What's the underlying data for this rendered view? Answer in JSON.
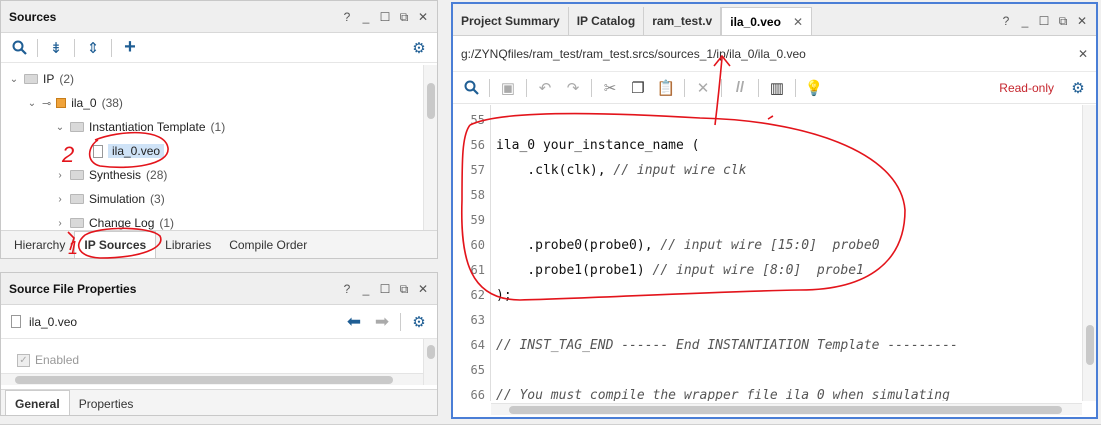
{
  "sources": {
    "title": "Sources",
    "tree": [
      {
        "label": "IP",
        "count": "(2)"
      },
      {
        "label": "ila_0",
        "count": "(38)"
      },
      {
        "label": "Instantiation Template",
        "count": "(1)"
      },
      {
        "label": "ila_0.veo",
        "count": ""
      },
      {
        "label": "Synthesis",
        "count": "(28)"
      },
      {
        "label": "Simulation",
        "count": "(3)"
      },
      {
        "label": "Change Log",
        "count": "(1)"
      }
    ],
    "tabs": [
      "Hierarchy",
      "IP Sources",
      "Libraries",
      "Compile Order"
    ]
  },
  "properties": {
    "title": "Source File Properties",
    "file": "ila_0.veo",
    "enabled_label": "Enabled",
    "tabs": [
      "General",
      "Properties"
    ]
  },
  "editor": {
    "tabs": [
      "Project Summary",
      "IP Catalog",
      "ram_test.v",
      "ila_0.veo"
    ],
    "path": "g:/ZYNQfiles/ram_test/ram_test.srcs/sources_1/ip/ila_0/ila_0.veo",
    "readonly": "Read-only",
    "lines": [
      {
        "n": "55",
        "code": "",
        "comment": ""
      },
      {
        "n": "56",
        "code": "ila_0 your_instance_name (",
        "comment": ""
      },
      {
        "n": "57",
        "code": "    .clk(clk), ",
        "comment": "// input wire clk"
      },
      {
        "n": "58",
        "code": "",
        "comment": ""
      },
      {
        "n": "59",
        "code": "",
        "comment": ""
      },
      {
        "n": "60",
        "code": "    .probe0(probe0), ",
        "comment": "// input wire [15:0]  probe0"
      },
      {
        "n": "61",
        "code": "    .probe1(probe1) ",
        "comment": "// input wire [8:0]  probe1"
      },
      {
        "n": "62",
        "code": ");",
        "comment": ""
      },
      {
        "n": "63",
        "code": "",
        "comment": ""
      },
      {
        "n": "64",
        "code": "",
        "comment": "// INST_TAG_END ------ End INSTANTIATION Template ---------"
      },
      {
        "n": "65",
        "code": "",
        "comment": ""
      },
      {
        "n": "66",
        "code": "",
        "comment": "// You must compile the wrapper file ila_0 when simulating"
      }
    ]
  },
  "annotations": {
    "mark1": "1",
    "mark2": "2"
  },
  "colors": {
    "accent": "#1f5e94",
    "readonly": "#c6262e",
    "annotation": "#e3141b",
    "editor_frame": "#4a7ed6"
  }
}
